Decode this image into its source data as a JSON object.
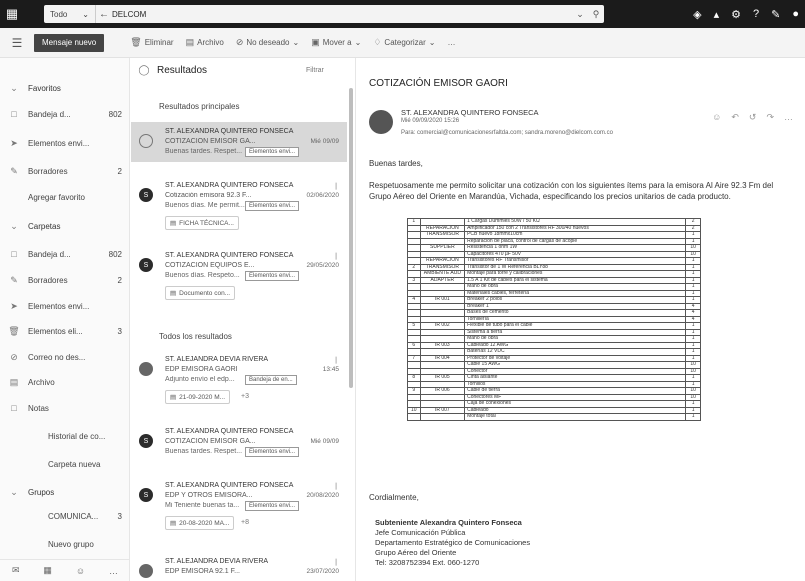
{
  "topbar": {
    "scope": "Todo",
    "search_value": "DELCOM"
  },
  "cmdbar": {
    "new_message": "Mensaje nuevo",
    "delete": "Eliminar",
    "archive": "Archivo",
    "junk": "No deseado",
    "move": "Mover a",
    "categorize": "Categorizar"
  },
  "nav": {
    "favorites": "Favoritos",
    "inbox_fav": "Bandeja d...",
    "inbox_fav_count": "802",
    "sent_fav": "Elementos envi...",
    "drafts_fav": "Borradores",
    "drafts_fav_count": "2",
    "add_favorite": "Agregar favorito",
    "folders": "Carpetas",
    "inbox": "Bandeja d...",
    "inbox_count": "802",
    "drafts": "Borradores",
    "drafts_count": "2",
    "sent": "Elementos envi...",
    "deleted": "Elementos eli...",
    "deleted_count": "3",
    "junk": "Correo no des...",
    "archive": "Archivo",
    "notes": "Notas",
    "history": "Historial de co...",
    "new_folder": "Carpeta nueva",
    "groups": "Grupos",
    "group_1": "COMUNICA...",
    "group_1_count": "3",
    "new_group": "Nuevo grupo"
  },
  "list": {
    "title": "Resultados",
    "filter": "Filtrar",
    "top_results": "Resultados principales",
    "all_results": "Todos los resultados",
    "messages": [
      {
        "sender": "ST. ALEXANDRA QUINTERO FONSECA",
        "subject": "COTIZACIÓN EMISOR GA...",
        "preview": "Buenas tardes. Respet...",
        "date": "Mié 09/09",
        "tag": "Elementos envi..."
      },
      {
        "sender": "ST. ALEXANDRA QUINTERO FONSECA",
        "subject": "Cotización emisora 92.3 F...",
        "preview": "Buenos días. Me permit...",
        "date": "02/06/2020",
        "tag": "Elementos envi...",
        "attachment": "FICHA TÉCNICA..."
      },
      {
        "sender": "ST. ALEXANDRA QUINTERO FONSECA",
        "subject": "COTIZACION EQUIPOS E...",
        "preview": "Buenos días. Respeto...",
        "date": "29/05/2020",
        "tag": "Elementos envi...",
        "attachment": "Documento con..."
      },
      {
        "sender": "ST. ALEJANDRA DEVIA RIVERA",
        "subject": "EDP EMISORA GAORI",
        "preview": "Adjunto envío el edp...",
        "date": "13:45",
        "tag": "Bandeja de en...",
        "attachment": "21-09-2020 M...",
        "extra": "+3"
      },
      {
        "sender": "ST. ALEXANDRA QUINTERO FONSECA",
        "subject": "COTIZACIÓN EMISOR GA...",
        "preview": "Buenas tardes. Respet...",
        "date": "Mié 09/09",
        "tag": "Elementos envi..."
      },
      {
        "sender": "ST. ALEXANDRA QUINTERO FONSECA",
        "subject": "EDP Y OTROS EMISORA...",
        "preview": "Mi Teniente buenas ta...",
        "date": "20/08/2020",
        "tag": "Elementos envi...",
        "attachment": "20-08-2020 MA...",
        "extra": "+8"
      },
      {
        "sender": "ST. ALEJANDRA DEVIA RIVERA",
        "subject": "EDP EMISORA 92.1 F...",
        "preview": "",
        "date": "23/07/2020",
        "tag": ""
      }
    ]
  },
  "reading": {
    "subject": "COTIZACIÓN EMISOR GAORI",
    "sender": "ST. ALEXANDRA QUINTERO FONSECA",
    "date": "Mié 09/09/2020 15:26",
    "to": "Para: comercial@comunicacionesrfaltda.com; sandra.moreno@dielcom.com.co",
    "greeting": "Buenas tardes,",
    "body": "Respetuosamente me permito solicitar una cotización con los siguientes ítems para la emisora Al Aire 92.3 Fm del Grupo Aéreo del Oriente en Marandúa, Vichada, especificando los precios unitarios de cada producto.",
    "closing": "Cordialmente,",
    "sig_name": "Subteniente Alexandra Quintero Fonseca",
    "sig_role": "Jefe Comunicación Pública",
    "sig_dept": "Departamento Estratégico de Comunicaciones",
    "sig_group": "Grupo Aéreo del Oriente",
    "sig_tel": "Tel: 3208752394 Ext. 060-1270"
  },
  "table_rows": [
    [
      "1",
      "",
      "1 Cargas Dummies 50W / 50 KΩ",
      "2"
    ],
    [
      "",
      "REPARACIÓN",
      "Amplificador 150 con 2 Transistores RF 300/40 nuevos",
      "2"
    ],
    [
      "",
      "TRANSMISOR",
      "PCB nuevo 18mmx10cm",
      "1"
    ],
    [
      "",
      "",
      "Reparación de placa, control de cargas de acople",
      "1"
    ],
    [
      "",
      "SUPPLIER",
      "Resistencia 1 ohm 1W",
      "10"
    ],
    [
      "",
      "",
      "Capacitores 470 µF 50V",
      "10"
    ],
    [
      "",
      "REPARACIÓN",
      "Transistores RF Transmisor",
      "1"
    ],
    [
      "2",
      "TRANSMISOR",
      "Transistor de 1 W Referencia BLY88",
      "1"
    ],
    [
      "",
      "AMBIENTE AUD",
      "Montaje para torre y calibraciones",
      "1"
    ],
    [
      "3",
      "ADAPTER",
      "1.5 A 1 Kit de cables para el sistema",
      "1"
    ],
    [
      "",
      "",
      "Mano de obra",
      "1"
    ],
    [
      "",
      "",
      "Materiales cables, ferretería",
      "1"
    ],
    [
      "4",
      "IR 001",
      "Breaker 2 polos",
      "1"
    ],
    [
      "",
      "",
      "Breaker 1",
      "4"
    ],
    [
      "",
      "",
      "Bases de cemento",
      "4"
    ],
    [
      "",
      "",
      "Tornillería",
      "4"
    ],
    [
      "5",
      "IR 002",
      "Flexible de tubo para el cable",
      "1"
    ],
    [
      "",
      "",
      "Sistema a tierra",
      "1"
    ],
    [
      "",
      "",
      "Mano de obra",
      "1"
    ],
    [
      "6",
      "IR 003",
      "Cableado 12 AWG",
      "1"
    ],
    [
      "",
      "",
      "Baterías 12 VDC",
      "1"
    ],
    [
      "7",
      "IR 004",
      "Protector de voltaje",
      "1"
    ],
    [
      "",
      "",
      "Cable 15 AWG",
      "10"
    ],
    [
      "",
      "",
      "Conector",
      "10"
    ],
    [
      "8",
      "IR 005",
      "Cinta aislante",
      "1"
    ],
    [
      "",
      "",
      "Tornillos",
      "1"
    ],
    [
      "9",
      "IR 006",
      "Cable de tierra",
      "10"
    ],
    [
      "",
      "",
      "Conectores MF",
      "10"
    ],
    [
      "",
      "",
      "Caja de conexiones",
      "1"
    ],
    [
      "10",
      "IR 007",
      "Cableado",
      "1"
    ],
    [
      "",
      "",
      "Montaje total",
      "1"
    ]
  ]
}
